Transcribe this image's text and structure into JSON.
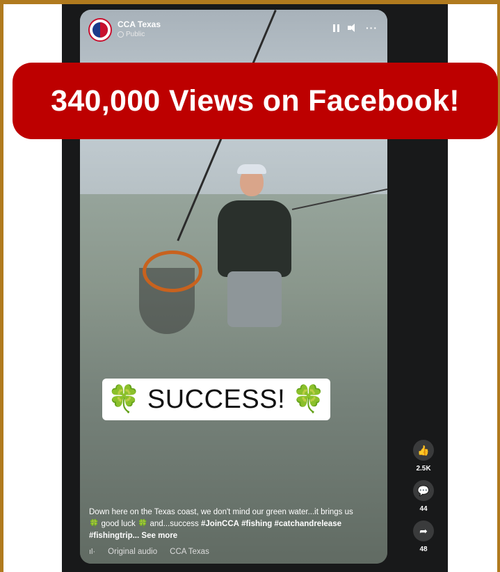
{
  "banner": {
    "text": "340,000 Views on Facebook!",
    "color": "#bd0000"
  },
  "header": {
    "page_name": "CCA Texas",
    "privacy": "Public"
  },
  "icons": {
    "pause": "pause-icon",
    "volume": "volume-icon",
    "more": "more-icon",
    "globe": "globe-icon",
    "like": "like-icon",
    "comment": "comment-icon",
    "share": "share-icon"
  },
  "overlay": {
    "clover_left": "🍀",
    "text": "SUCCESS!",
    "clover_right": "🍀"
  },
  "actions": {
    "likes": "2.5K",
    "comments": "44",
    "shares": "48"
  },
  "caption": {
    "line1": "Down here on the Texas coast, we don't mind our green water...it brings us",
    "clover": "🍀",
    "good_luck": " good luck ",
    "and_success": " and...success ",
    "tag1": "#JoinCCA",
    "tag2": "#fishing",
    "tag3": "#catchandrelease",
    "tag4": "#fishingtrip...",
    "see_more": "See more"
  },
  "audio": {
    "icon": "ıl·",
    "label": "Original audio",
    "artist": "CCA Texas"
  },
  "colors": {
    "frame": "#b07a1e",
    "clover": "#3aa535"
  }
}
